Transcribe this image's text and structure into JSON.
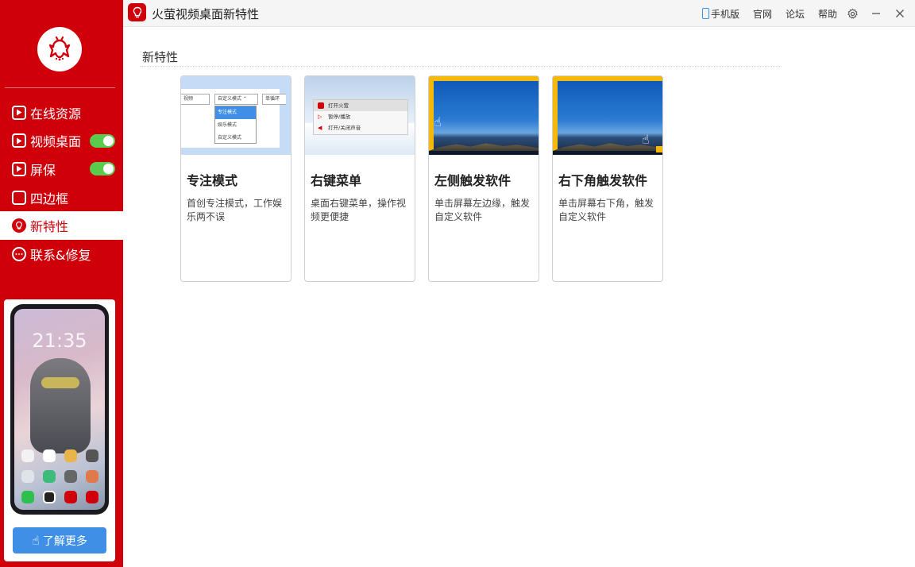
{
  "colors": {
    "brand": "#d0000b",
    "toggle_on": "#5bcb4e",
    "accent_blue": "#3f8fe6",
    "highlight_yellow": "#f5b90c"
  },
  "titlebar": {
    "title": "火萤视频桌面新特性",
    "links": [
      "手机版",
      "官网",
      "论坛",
      "帮助"
    ]
  },
  "sidebar": {
    "items": [
      {
        "label": "在线资源",
        "icon": "play-icon",
        "toggle": false,
        "active": false
      },
      {
        "label": "视频桌面",
        "icon": "play-icon",
        "toggle": true,
        "active": false
      },
      {
        "label": "屏保",
        "icon": "play-icon",
        "toggle": true,
        "active": false
      },
      {
        "label": "四边框",
        "icon": "square-icon",
        "toggle": false,
        "active": false
      },
      {
        "label": "新特性",
        "icon": "bulb-icon",
        "toggle": false,
        "active": true
      },
      {
        "label": "联系&修复",
        "icon": "chat-icon",
        "toggle": false,
        "active": false
      }
    ],
    "promo": {
      "clock": "21:35",
      "button_label": "了解更多"
    }
  },
  "main": {
    "section_title": "新特性",
    "cards": [
      {
        "title": "专注模式",
        "desc": "首创专注模式，工作娱乐两不误",
        "thumb": {
          "inputs": [
            "视频",
            "自定义模式 ⌃",
            "单循环"
          ],
          "menu": [
            "专注模式",
            "娱乐模式",
            "自定义模式"
          ]
        }
      },
      {
        "title": "右键菜单",
        "desc": "桌面右键菜单，操作视频更便捷",
        "thumb": {
          "menu": [
            "打开火萤",
            "暂停/播放",
            "打开/关闭声音"
          ]
        }
      },
      {
        "title": "左侧触发软件",
        "desc": "单击屏幕左边缘，触发自定义软件"
      },
      {
        "title": "右下角触发软件",
        "desc": "单击屏幕右下角，触发自定义软件"
      }
    ]
  }
}
